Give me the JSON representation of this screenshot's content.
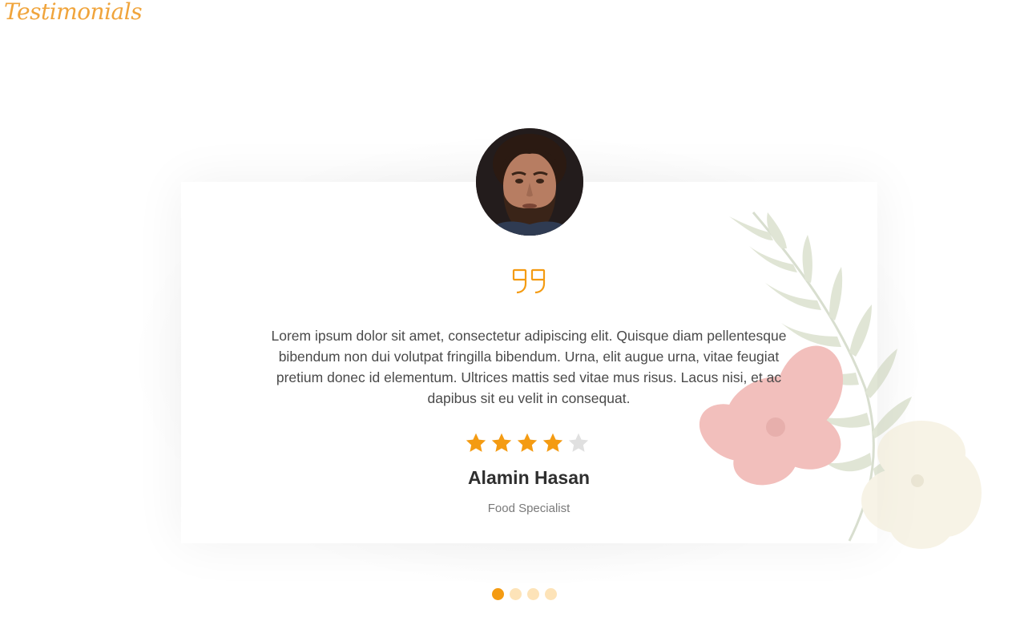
{
  "section": {
    "title": "Testimonials"
  },
  "testimonial": {
    "quote": "Lorem ipsum dolor sit amet, consectetur adipiscing elit. Quisque diam pellentesque bibendum non dui volutpat fringilla bibendum. Urna, elit augue urna, vitae feugiat pretium donec id elementum. Ultrices mattis sed vitae mus risus. Lacus nisi, et ac dapibus sit eu velit in consequat.",
    "rating": 4,
    "rating_max": 5,
    "name": "Alamin Hasan",
    "role": "Food Specialist",
    "avatar_icon": "person-portrait-avatar",
    "quote_icon": "quote-icon"
  },
  "pagination": {
    "count": 4,
    "active_index": 0
  },
  "colors": {
    "accent": "#f49b12",
    "accent_light": "#fde3b8",
    "star_empty": "#e0e0e0",
    "text": "#4a4a4a",
    "name": "#2f2f2f",
    "role": "#7a7a7a"
  }
}
